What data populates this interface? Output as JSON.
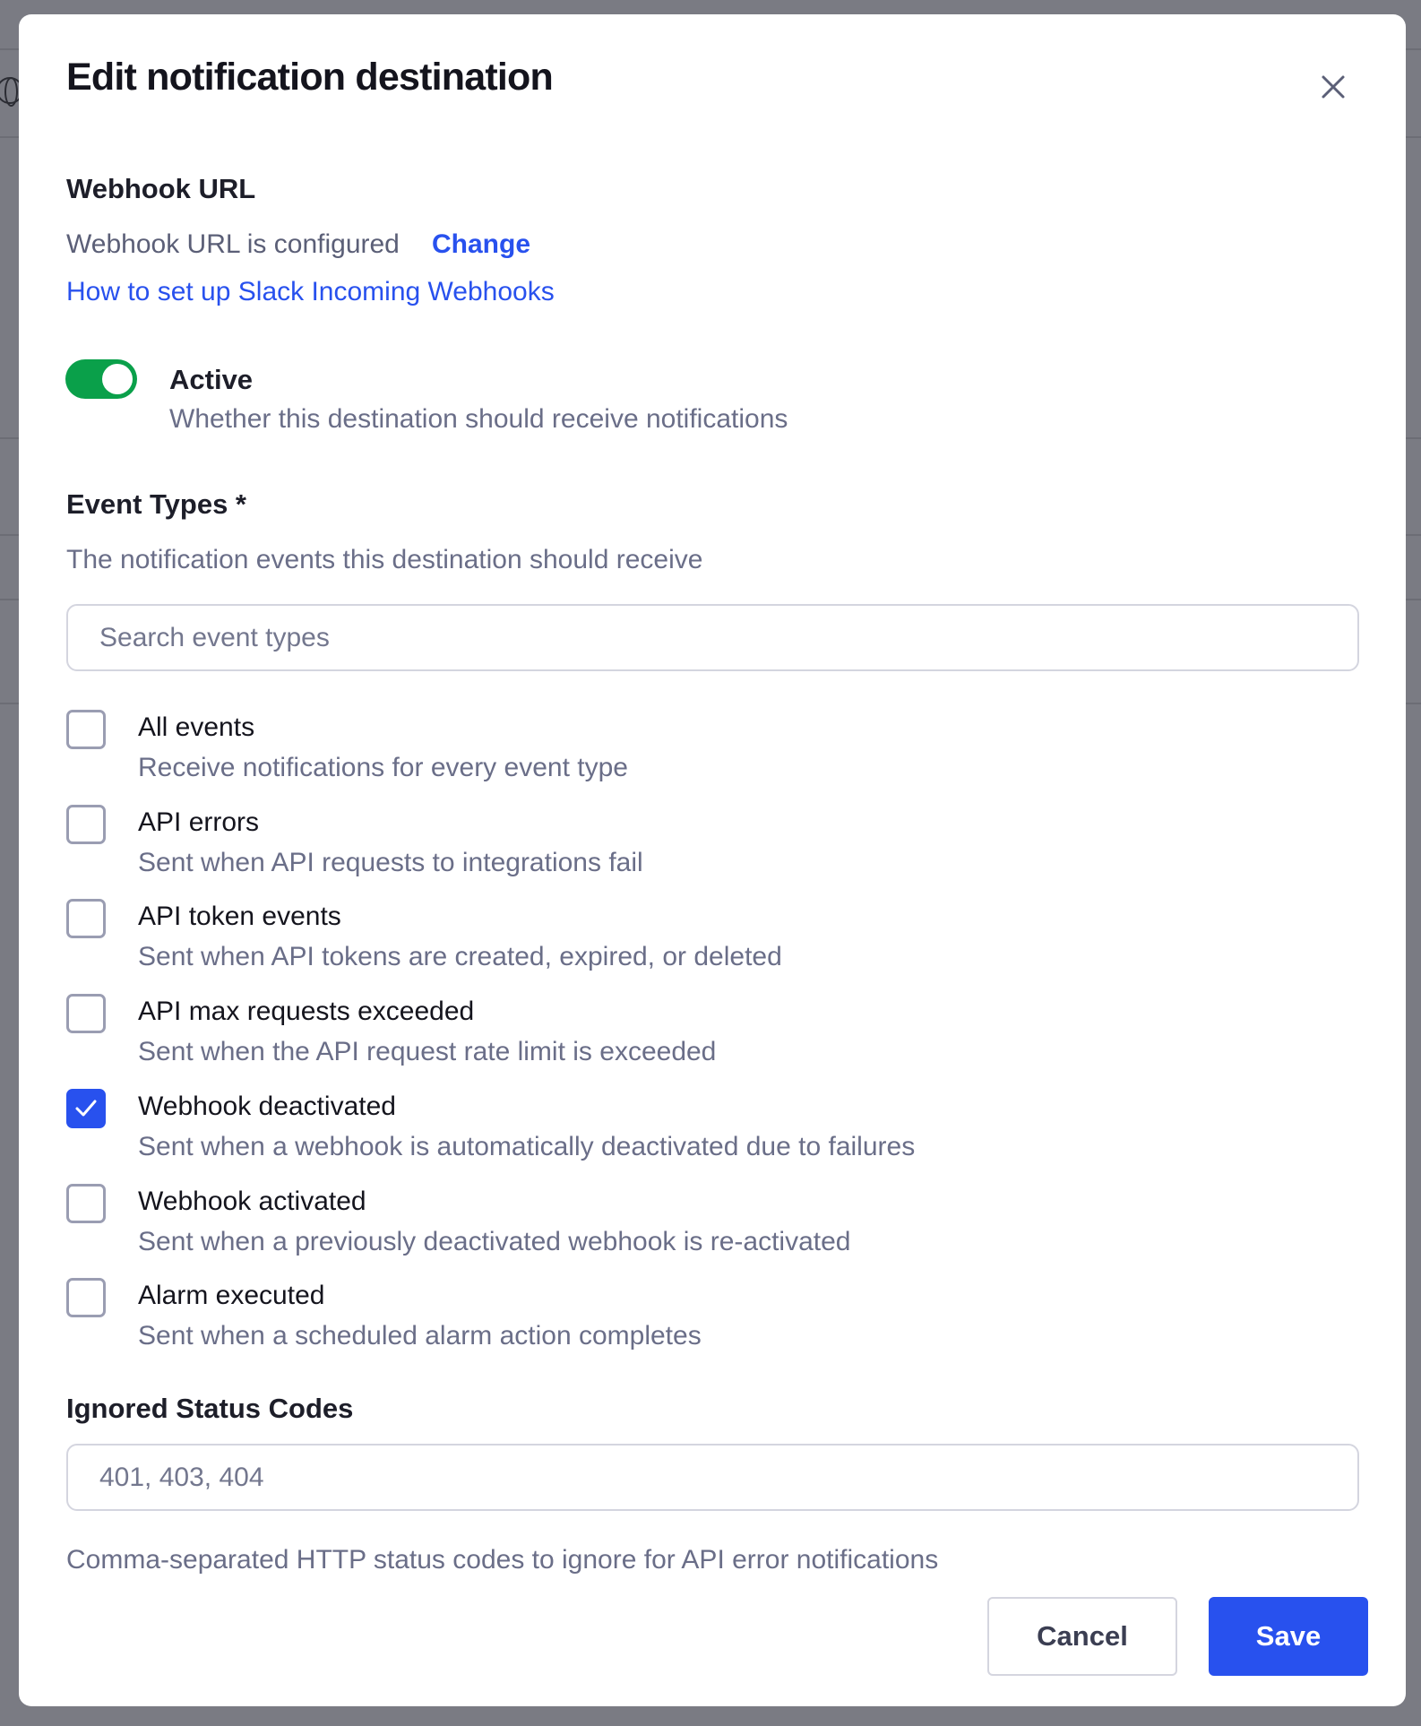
{
  "dialog": {
    "title": "Edit notification destination"
  },
  "webhook": {
    "section_label": "Webhook URL",
    "status_text": "Webhook URL is configured",
    "change_link": "Change",
    "help_link": "How to set up Slack Incoming Webhooks"
  },
  "active": {
    "label": "Active",
    "description": "Whether this destination should receive notifications",
    "enabled": true,
    "color": "#0aa04a"
  },
  "event_types": {
    "label": "Event Types *",
    "description": "The notification events this destination should receive",
    "search_placeholder": "Search event types",
    "items": [
      {
        "label": "All events",
        "description": "Receive notifications for every event type",
        "checked": false
      },
      {
        "label": "API errors",
        "description": "Sent when API requests to integrations fail",
        "checked": false
      },
      {
        "label": "API token events",
        "description": "Sent when API tokens are created, expired, or deleted",
        "checked": false
      },
      {
        "label": "API max requests exceeded",
        "description": "Sent when the API request rate limit is exceeded",
        "checked": false
      },
      {
        "label": "Webhook deactivated",
        "description": "Sent when a webhook is automatically deactivated due to failures",
        "checked": true
      },
      {
        "label": "Webhook activated",
        "description": "Sent when a previously deactivated webhook is re-activated",
        "checked": false
      },
      {
        "label": "Alarm executed",
        "description": "Sent when a scheduled alarm action completes",
        "checked": false
      }
    ]
  },
  "ignored_status_codes": {
    "label": "Ignored Status Codes",
    "placeholder": "401, 403, 404",
    "help_text": "Comma-separated HTTP status codes to ignore for API error notifications"
  },
  "footer": {
    "cancel_label": "Cancel",
    "save_label": "Save"
  },
  "colors": {
    "accent": "#2851ee",
    "backdrop": "#6f7079"
  }
}
